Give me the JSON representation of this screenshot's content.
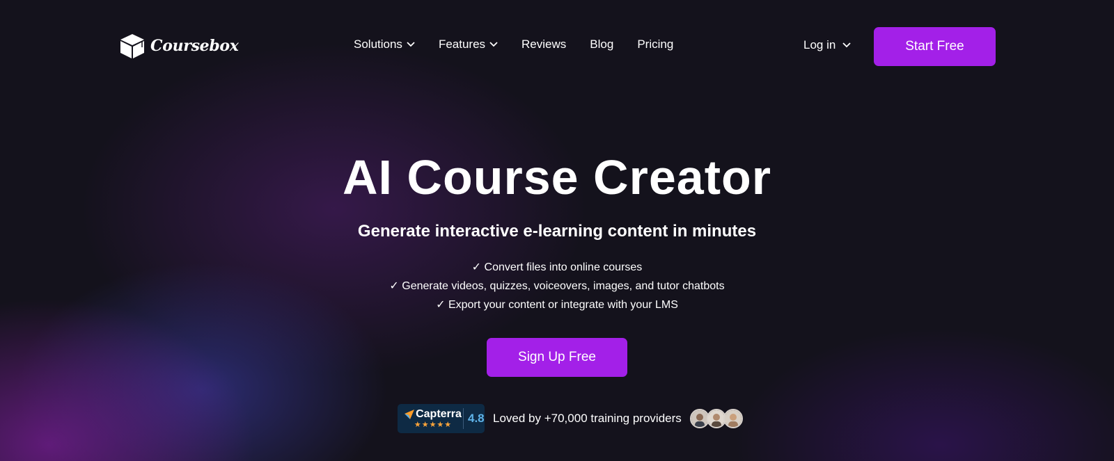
{
  "brand": {
    "name": "Coursebox"
  },
  "nav": {
    "items": [
      {
        "label": "Solutions",
        "dropdown": true
      },
      {
        "label": "Features",
        "dropdown": true
      },
      {
        "label": "Reviews",
        "dropdown": false
      },
      {
        "label": "Blog",
        "dropdown": false
      },
      {
        "label": "Pricing",
        "dropdown": false
      }
    ],
    "login_label": "Log in",
    "start_label": "Start Free"
  },
  "hero": {
    "title": "AI Course Creator",
    "subtitle": "Generate interactive e-learning content in minutes",
    "bullets": [
      "✓ Convert files into online courses",
      "✓ Generate videos, quizzes, voiceovers, images, and tutor chatbots",
      "✓ Export your content or integrate with your LMS"
    ],
    "cta_label": "Sign Up Free"
  },
  "social_proof": {
    "capterra_name": "Capterra",
    "stars": "★★★★★",
    "rating": "4.8",
    "loved_text": "Loved by +70,000 training providers"
  },
  "colors": {
    "accent": "#a320e8",
    "background": "#14121c",
    "capterra_bg": "#0e2a44",
    "star": "#ffa53a"
  },
  "icons": [
    "cube-logo-icon",
    "chevron-down-icon",
    "capterra-arrow-icon",
    "star-icon",
    "avatar"
  ]
}
